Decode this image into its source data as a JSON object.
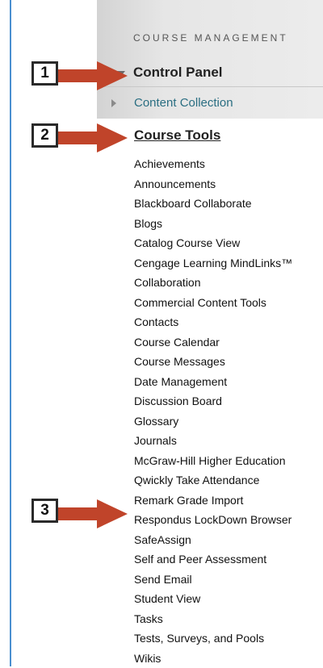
{
  "menu": {
    "section_header": "COURSE MANAGEMENT",
    "control_panel": "Control Panel",
    "content_collection": "Content Collection",
    "course_tools_title": "Course Tools",
    "tools": [
      "Achievements",
      "Announcements",
      "Blackboard Collaborate",
      "Blogs",
      "Catalog Course View",
      "Cengage Learning MindLinks™",
      "Collaboration",
      "Commercial Content Tools",
      "Contacts",
      "Course Calendar",
      "Course Messages",
      "Date Management",
      "Discussion Board",
      "Glossary",
      "Journals",
      "McGraw-Hill Higher Education",
      "Qwickly Take Attendance",
      "Remark Grade Import",
      "Respondus LockDown Browser",
      "SafeAssign",
      "Self and Peer Assessment",
      "Send Email",
      "Student View",
      "Tasks",
      "Tests, Surveys, and Pools",
      "Wikis"
    ]
  },
  "annotations": {
    "callout_1": "1",
    "callout_2": "2",
    "callout_3": "3",
    "arrow_color": "#c0442a"
  },
  "colors": {
    "panel_border": "#4a8fd0",
    "link_teal": "#2a6e82"
  }
}
